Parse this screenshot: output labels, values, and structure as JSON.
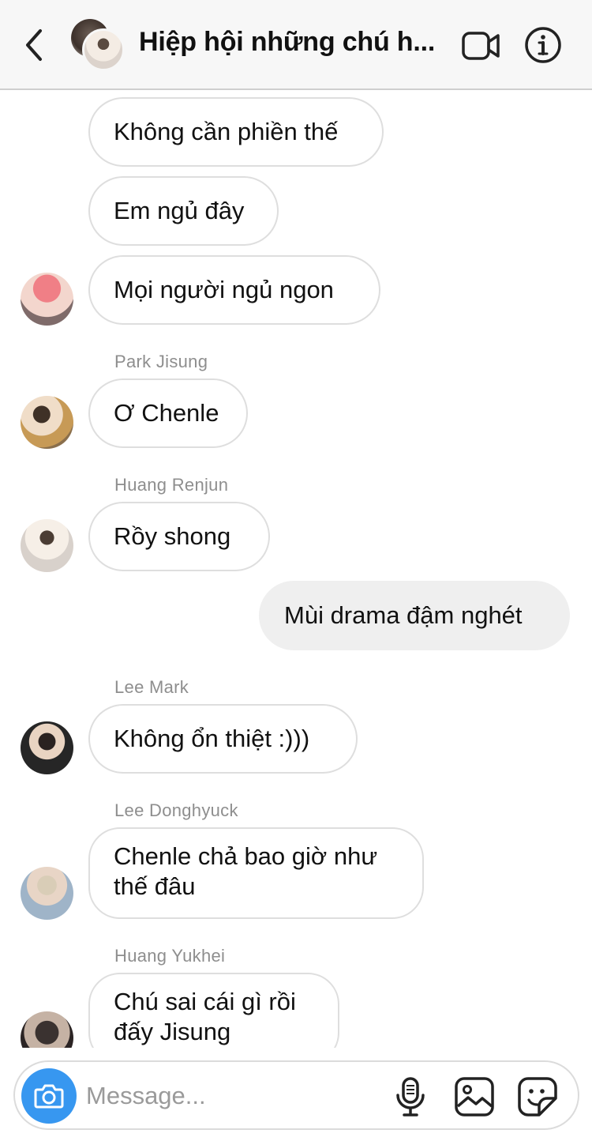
{
  "header": {
    "title": "Hiệp hội những chú h...",
    "back_icon": "chevron-left-icon",
    "video_icon": "video-camera-icon",
    "info_icon": "info-icon"
  },
  "messages": [
    {
      "text": "Không cần phiền thế"
    },
    {
      "text": "Em ngủ đây"
    },
    {
      "text": "Mọi người ngủ ngon"
    },
    {
      "sender": "Park Jisung",
      "text": "Ơ Chenle"
    },
    {
      "sender": "Huang Renjun",
      "text": "Rồy shong"
    },
    {
      "text": "Mùi drama đậm nghét"
    },
    {
      "sender": "Lee Mark",
      "text": "Không ổn thiệt :)))"
    },
    {
      "sender": "Lee Donghyuck",
      "line1": "Chenle chả bao giờ như",
      "line2": "thế đâu"
    },
    {
      "sender": "Huang Yukhei",
      "line1": "Chú sai cái gì rồi",
      "line2": "đấy Jisung"
    }
  ],
  "composer": {
    "placeholder": "Message...",
    "camera_icon": "camera-icon",
    "mic_icon": "microphone-icon",
    "gallery_icon": "image-icon",
    "sticker_icon": "sticker-icon"
  },
  "colors": {
    "header_bg": "#f7f7f7",
    "own_bubble": "#efefef",
    "camera_button": "#3797f0",
    "sender_text": "#8e8e8e"
  }
}
